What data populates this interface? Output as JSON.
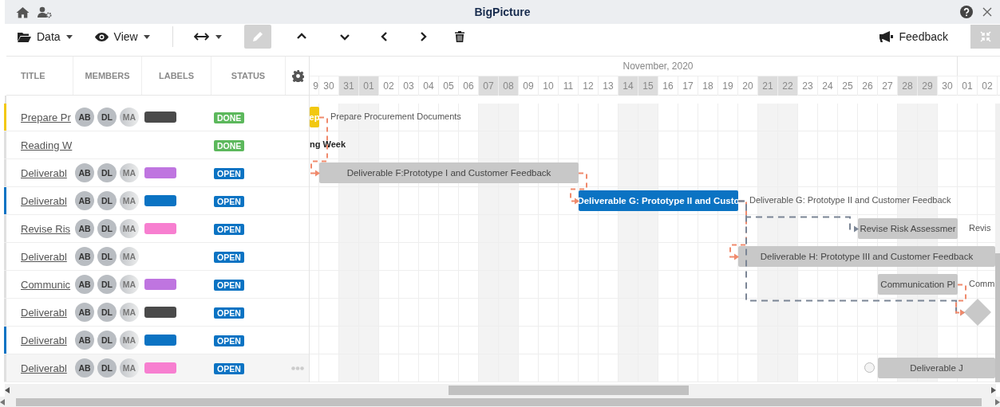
{
  "window": {
    "title": "BigPicture"
  },
  "toolbar": {
    "data_menu": "Data",
    "view_menu": "View",
    "feedback": "Feedback",
    "edit_disabled": true
  },
  "grid": {
    "columns": [
      "TITLE",
      "MEMBERS",
      "LABELS",
      "STATUS"
    ]
  },
  "timeline": {
    "months": [
      "November, 2020"
    ],
    "days": [
      {
        "label": "9",
        "weekend": false
      },
      {
        "label": "30",
        "weekend": false
      },
      {
        "label": "31",
        "weekend": true
      },
      {
        "label": "01",
        "weekend": true
      },
      {
        "label": "02",
        "weekend": false
      },
      {
        "label": "03",
        "weekend": false
      },
      {
        "label": "04",
        "weekend": false
      },
      {
        "label": "05",
        "weekend": false
      },
      {
        "label": "06",
        "weekend": false
      },
      {
        "label": "07",
        "weekend": true
      },
      {
        "label": "08",
        "weekend": true
      },
      {
        "label": "09",
        "weekend": false
      },
      {
        "label": "10",
        "weekend": false
      },
      {
        "label": "11",
        "weekend": false
      },
      {
        "label": "12",
        "weekend": false
      },
      {
        "label": "13",
        "weekend": false
      },
      {
        "label": "14",
        "weekend": true
      },
      {
        "label": "15",
        "weekend": true
      },
      {
        "label": "16",
        "weekend": false
      },
      {
        "label": "17",
        "weekend": false
      },
      {
        "label": "18",
        "weekend": false
      },
      {
        "label": "19",
        "weekend": false
      },
      {
        "label": "20",
        "weekend": false
      },
      {
        "label": "21",
        "weekend": true
      },
      {
        "label": "22",
        "weekend": true
      },
      {
        "label": "23",
        "weekend": false
      },
      {
        "label": "24",
        "weekend": false
      },
      {
        "label": "25",
        "weekend": false
      },
      {
        "label": "26",
        "weekend": false
      },
      {
        "label": "27",
        "weekend": false
      },
      {
        "label": "28",
        "weekend": true
      },
      {
        "label": "29",
        "weekend": true
      },
      {
        "label": "30",
        "weekend": false
      },
      {
        "label": "01",
        "weekend": false
      },
      {
        "label": "02",
        "weekend": false
      }
    ]
  },
  "rows": [
    {
      "title": "Prepare Pr",
      "accent": {
        "color": "#f2c811"
      },
      "members": [
        "AB",
        "DL",
        "MA"
      ],
      "label": {
        "color": "#4a4a4a"
      },
      "status": {
        "label": "DONE",
        "color": "#5cb85c"
      },
      "hovered": false,
      "task": {
        "kind": "bar",
        "name": "ep",
        "color": "#f2c811",
        "caption": "Prepare Procurement Documents"
      }
    },
    {
      "title": "Reading W",
      "status": {
        "label": "DONE",
        "color": "#5cb85c"
      },
      "hovered": false,
      "task": {
        "kind": "text",
        "name": "ng Week"
      }
    },
    {
      "title": "Deliverabl",
      "members": [
        "AB",
        "DL",
        "MA"
      ],
      "label": {
        "color": "#bf75e0"
      },
      "status": {
        "label": "OPEN",
        "color": "#0b73c3"
      },
      "hovered": false,
      "task": {
        "kind": "bar",
        "name": "Deliverable F:Prototype I and Customer Feedback",
        "color": "#c8c8c8"
      }
    },
    {
      "title": "Deliverabl",
      "accent": {
        "color": "#0b73c3"
      },
      "members": [
        "AB",
        "DL",
        "MA"
      ],
      "label": {
        "color": "#0b73c3"
      },
      "status": {
        "label": "OPEN",
        "color": "#0b73c3"
      },
      "hovered": false,
      "task": {
        "kind": "bar",
        "name": "Deliverable G: Prototype II and Custo",
        "color": "#0b73c3",
        "caption": "Deliverable G: Prototype II and Customer Feedback"
      }
    },
    {
      "title": "Revise Ris",
      "members": [
        "AB",
        "DL",
        "MA"
      ],
      "label": {
        "color": "#f77fd0"
      },
      "status": {
        "label": "OPEN",
        "color": "#0b73c3"
      },
      "hovered": false,
      "task": {
        "kind": "bar",
        "name": "Revise Risk Assessmer",
        "color": "#c8c8c8",
        "caption": "Revis"
      }
    },
    {
      "title": "Deliverabl",
      "members": [
        "AB",
        "DL",
        "MA"
      ],
      "status": {
        "label": "OPEN",
        "color": "#0b73c3"
      },
      "hovered": false,
      "task": {
        "kind": "bar",
        "name": "Deliverable H: Prototype III and Customer Feedback",
        "color": "#c8c8c8"
      }
    },
    {
      "title": "Communic",
      "members": [
        "AB",
        "DL",
        "MA"
      ],
      "label": {
        "color": "#bf75e0"
      },
      "status": {
        "label": "OPEN",
        "color": "#0b73c3"
      },
      "hovered": false,
      "task": {
        "kind": "bar",
        "name": "Communication Pl",
        "color": "#c8c8c8",
        "caption": "Comm"
      }
    },
    {
      "title": "Deliverabl",
      "members": [
        "AB",
        "DL",
        "MA"
      ],
      "label": {
        "color": "#4a4a4a"
      },
      "status": {
        "label": "OPEN",
        "color": "#0b73c3"
      },
      "hovered": false,
      "task": {
        "kind": "milestone"
      }
    },
    {
      "title": "Deliverabl",
      "accent": {
        "color": "#0b73c3"
      },
      "members": [
        "AB",
        "DL",
        "MA"
      ],
      "label": {
        "color": "#0b73c3"
      },
      "status": {
        "label": "OPEN",
        "color": "#0b73c3"
      },
      "hovered": false
    },
    {
      "title": "Deliverabl",
      "members": [
        "AB",
        "DL",
        "MA"
      ],
      "label": {
        "color": "#f77fd0"
      },
      "status": {
        "label": "OPEN",
        "color": "#0b73c3"
      },
      "hovered": true,
      "task": {
        "kind": "bar",
        "name": "Deliverable J",
        "color": "#c8c8c8"
      }
    }
  ],
  "dependencies": [
    {
      "kind": "critical"
    },
    {
      "kind": "critical"
    },
    {
      "kind": "critical"
    },
    {
      "kind": "normal"
    },
    {
      "kind": "normal"
    },
    {
      "kind": "critical"
    }
  ]
}
